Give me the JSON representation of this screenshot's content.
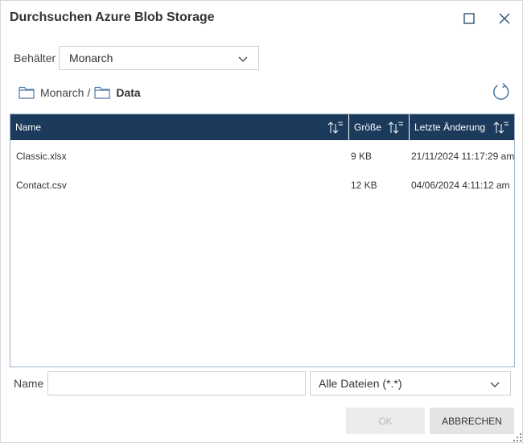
{
  "dialog": {
    "title": "Durchsuchen Azure Blob Storage"
  },
  "container": {
    "label": "Behälter",
    "selected": "Monarch"
  },
  "breadcrumb": {
    "items": [
      "Monarch",
      "Data"
    ],
    "separator": "/"
  },
  "grid": {
    "columns": [
      "Name",
      "Größe",
      "Letzte Änderung"
    ],
    "rows": [
      {
        "name": "Classic.xlsx",
        "size": "9 KB",
        "modified": "21/11/2024 11:17:29 am"
      },
      {
        "name": "Contact.csv",
        "size": "12 KB",
        "modified": "04/06/2024 4:11:12 am"
      }
    ]
  },
  "footer": {
    "name_label": "Name",
    "name_value": "",
    "filter_selected": "Alle Dateien (*.*)",
    "ok_label": "OK",
    "cancel_label": "ABBRECHEN"
  },
  "colors": {
    "header_bg": "#1b3a5c",
    "header_text": "#ffffff",
    "refresh_icon": "#4d7aa6"
  },
  "icons": [
    "maximize-icon",
    "close-icon",
    "chevron-down-icon",
    "folder-icon",
    "refresh-icon",
    "sort-icon",
    "resize-grip-icon"
  ]
}
